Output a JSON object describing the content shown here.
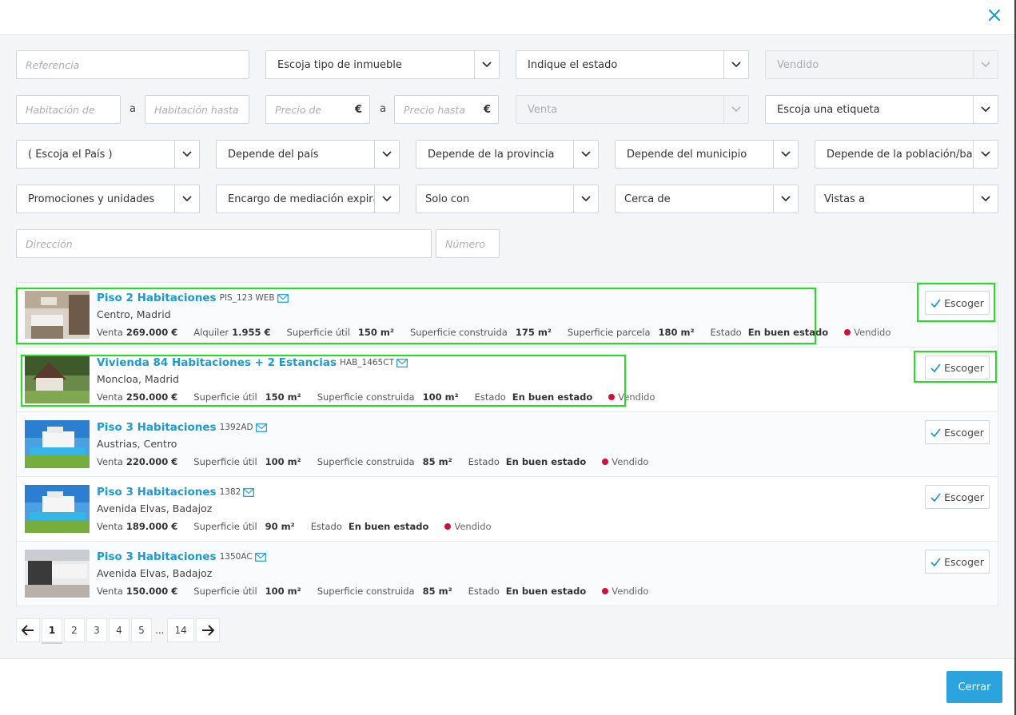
{
  "colors": {
    "accent": "#1b9ad6",
    "sold_dot": "#d0103a",
    "highlight": "#1ee21e",
    "close_button": "#2ba3dc"
  },
  "header": {
    "close_icon": "close-icon"
  },
  "filters": {
    "referencia": "Referencia",
    "tipo_inmueble": "Escoja tipo de inmueble",
    "estado": "Indique el estado",
    "vendido": "Vendido",
    "hab_de": "Habitación de",
    "a1": "a",
    "hab_hasta": "Habitación hasta",
    "precio_de": "Precio de",
    "euro1": "€",
    "a2": "a",
    "precio_hasta": "Precio hasta",
    "euro2": "€",
    "venta": "Venta",
    "etiqueta": "Escoja una etiqueta",
    "pais": "( Escoja el País )",
    "provincia_dep": "Depende del país",
    "municipio_dep": "Depende de la provincia",
    "poblacion_dep": "Depende del municipio",
    "barrio_dep": "Depende de la población/barrio",
    "promociones": "Promociones y unidades",
    "encargo": "Encargo de mediación expira en",
    "solo_con": "Solo con",
    "cerca_de": "Cerca de",
    "vistas": "Vistas a",
    "direccion": "Dirección",
    "numero": "Número"
  },
  "listings": [
    {
      "title": "Piso 2 Habitaciones",
      "ref": "PIS_123 WEB",
      "location": "Centro, Madrid",
      "venta_label": "Venta",
      "venta": "269.000 €",
      "alquiler_label": "Alquiler",
      "alquiler": "1.955 €",
      "sup_util_label": "Superficie útil",
      "sup_util": "150 m²",
      "sup_cons_label": "Superficie construida",
      "sup_cons": "175 m²",
      "sup_parc_label": "Superficie parcela",
      "sup_parc": "180 m²",
      "estado_label": "Estado",
      "estado": "En buen estado",
      "status": "Vendido",
      "button": "Escoger"
    },
    {
      "title": "Vivienda 84 Habitaciones + 2 Estancias",
      "ref": "HAB_1465CT",
      "location": "Moncloa, Madrid",
      "venta_label": "Venta",
      "venta": "250.000 €",
      "sup_util_label": "Superficie útil",
      "sup_util": "150 m²",
      "sup_cons_label": "Superficie construida",
      "sup_cons": "100 m²",
      "estado_label": "Estado",
      "estado": "En buen estado",
      "status": "Vendido",
      "button": "Escoger"
    },
    {
      "title": "Piso 3 Habitaciones",
      "ref": "1392AD",
      "location": "Austrias, Centro",
      "venta_label": "Venta",
      "venta": "220.000 €",
      "sup_util_label": "Superficie útil",
      "sup_util": "100 m²",
      "sup_cons_label": "Superficie construida",
      "sup_cons": "85 m²",
      "estado_label": "Estado",
      "estado": "En buen estado",
      "status": "Vendido",
      "button": "Escoger"
    },
    {
      "title": "Piso 3 Habitaciones",
      "ref": "1382",
      "location": "Avenida Elvas, Badajoz",
      "venta_label": "Venta",
      "venta": "189.000 €",
      "sup_util_label": "Superficie útil",
      "sup_util": "90 m²",
      "estado_label": "Estado",
      "estado": "En buen estado",
      "status": "Vendido",
      "button": "Escoger"
    },
    {
      "title": "Piso 3 Habitaciones",
      "ref": "1350AC",
      "location": "Avenida Elvas, Badajoz",
      "venta_label": "Venta",
      "venta": "150.000 €",
      "sup_util_label": "Superficie útil",
      "sup_util": "100 m²",
      "sup_cons_label": "Superficie construida",
      "sup_cons": "85 m²",
      "estado_label": "Estado",
      "estado": "En buen estado",
      "status": "Vendido",
      "button": "Escoger"
    }
  ],
  "pagination": {
    "pages": [
      "1",
      "2",
      "3",
      "4",
      "5"
    ],
    "ellipsis": "...",
    "last": "14",
    "current": "1"
  },
  "footer": {
    "close_label": "Cerrar"
  }
}
